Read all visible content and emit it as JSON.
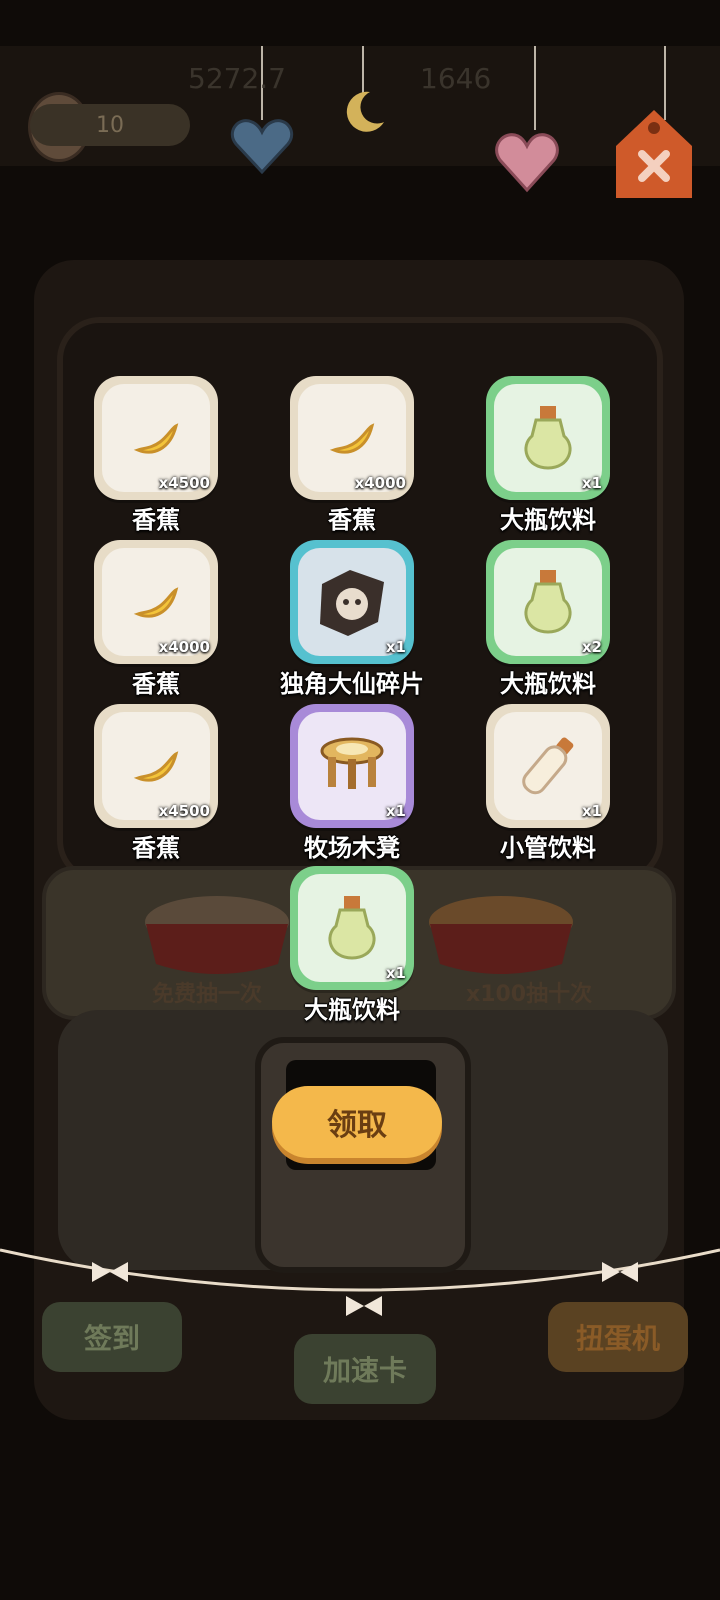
{
  "top": {
    "ticket_count": "10",
    "stat_1": "5272.7",
    "stat_2": "1646"
  },
  "machine": {
    "free_draw_label": "免费抽一次",
    "ten_draw_label": "x100抽十次"
  },
  "rewards": [
    {
      "name": "香蕉",
      "qty": "x4500",
      "rarity": "common"
    },
    {
      "name": "香蕉",
      "qty": "x4000",
      "rarity": "common"
    },
    {
      "name": "大瓶饮料",
      "qty": "x1",
      "rarity": "green"
    },
    {
      "name": "香蕉",
      "qty": "x4000",
      "rarity": "common"
    },
    {
      "name": "独角大仙碎片",
      "qty": "x1",
      "rarity": "blue"
    },
    {
      "name": "大瓶饮料",
      "qty": "x2",
      "rarity": "green"
    },
    {
      "name": "香蕉",
      "qty": "x4500",
      "rarity": "common"
    },
    {
      "name": "牧场木凳",
      "qty": "x1",
      "rarity": "purple"
    },
    {
      "name": "小管饮料",
      "qty": "x1",
      "rarity": "common"
    },
    {
      "name": "大瓶饮料",
      "qty": "x1",
      "rarity": "green"
    }
  ],
  "claim_button": "领取",
  "bottom_nav": {
    "checkin": "签到",
    "speedup": "加速卡",
    "gacha": "扭蛋机"
  },
  "colors": {
    "common_border": "#e7dcc7",
    "green_border": "#7ccf8a",
    "blue_border": "#56c1cf",
    "purple_border": "#a88ad8",
    "claim_button": "#f4b84b"
  },
  "icons": [
    "banana-icon",
    "potion-icon",
    "unicorn-shard-icon",
    "wooden-stool-icon",
    "tube-drink-icon",
    "heart-ornament-icon",
    "moon-ornament-icon",
    "tag-icon",
    "bow-icon"
  ]
}
